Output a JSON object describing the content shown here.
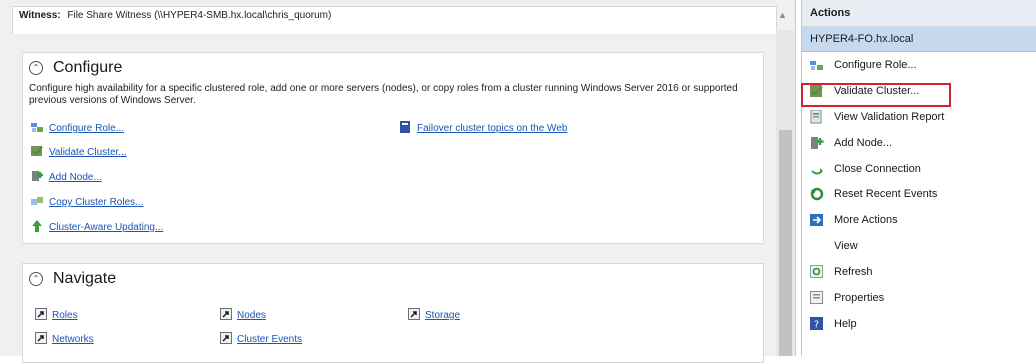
{
  "witness": {
    "label": "Witness:",
    "value": "File Share Witness (\\\\HYPER4-SMB.hx.local\\chris_quorum)"
  },
  "configure": {
    "title": "Configure",
    "collapse_glyph": "⌃",
    "description": "Configure high availability for a specific clustered role, add one or more servers (nodes), or copy roles from a cluster running Windows Server 2016 or supported previous versions of Windows Server.",
    "links": [
      {
        "label": "Configure Role...",
        "icon": "configure-role-icon"
      },
      {
        "label": "Validate Cluster...",
        "icon": "validate-cluster-icon"
      },
      {
        "label": "Add Node...",
        "icon": "add-node-icon"
      },
      {
        "label": "Copy Cluster Roles...",
        "icon": "copy-roles-icon"
      },
      {
        "label": "Cluster-Aware Updating...",
        "icon": "update-arrow-icon"
      }
    ],
    "web_link": {
      "label": "Failover cluster topics on the Web",
      "icon": "help-book-icon"
    }
  },
  "navigate": {
    "title": "Navigate",
    "collapse_glyph": "⌃",
    "links": [
      {
        "label": "Roles"
      },
      {
        "label": "Nodes"
      },
      {
        "label": "Storage"
      },
      {
        "label": "Networks"
      },
      {
        "label": "Cluster Events"
      }
    ]
  },
  "actions": {
    "header": "Actions",
    "group": "HYPER4-FO.hx.local",
    "items": [
      {
        "label": "Configure Role...",
        "icon": "configure-role-icon"
      },
      {
        "label": "Validate Cluster...",
        "icon": "validate-cluster-icon"
      },
      {
        "label": "View Validation Report",
        "icon": "report-icon"
      },
      {
        "label": "Add Node...",
        "icon": "add-node-icon"
      },
      {
        "label": "Close Connection",
        "icon": "close-connection-icon"
      },
      {
        "label": "Reset Recent Events",
        "icon": "reset-events-icon"
      },
      {
        "label": "More Actions",
        "icon": "more-actions-icon"
      },
      {
        "label": "View",
        "icon": ""
      },
      {
        "label": "Refresh",
        "icon": "refresh-icon"
      },
      {
        "label": "Properties",
        "icon": "properties-icon"
      },
      {
        "label": "Help",
        "icon": "help-icon"
      }
    ]
  },
  "colors": {
    "link": "#1a55b5",
    "highlight": "#d6222a",
    "group_bg": "#c7d9ee"
  }
}
